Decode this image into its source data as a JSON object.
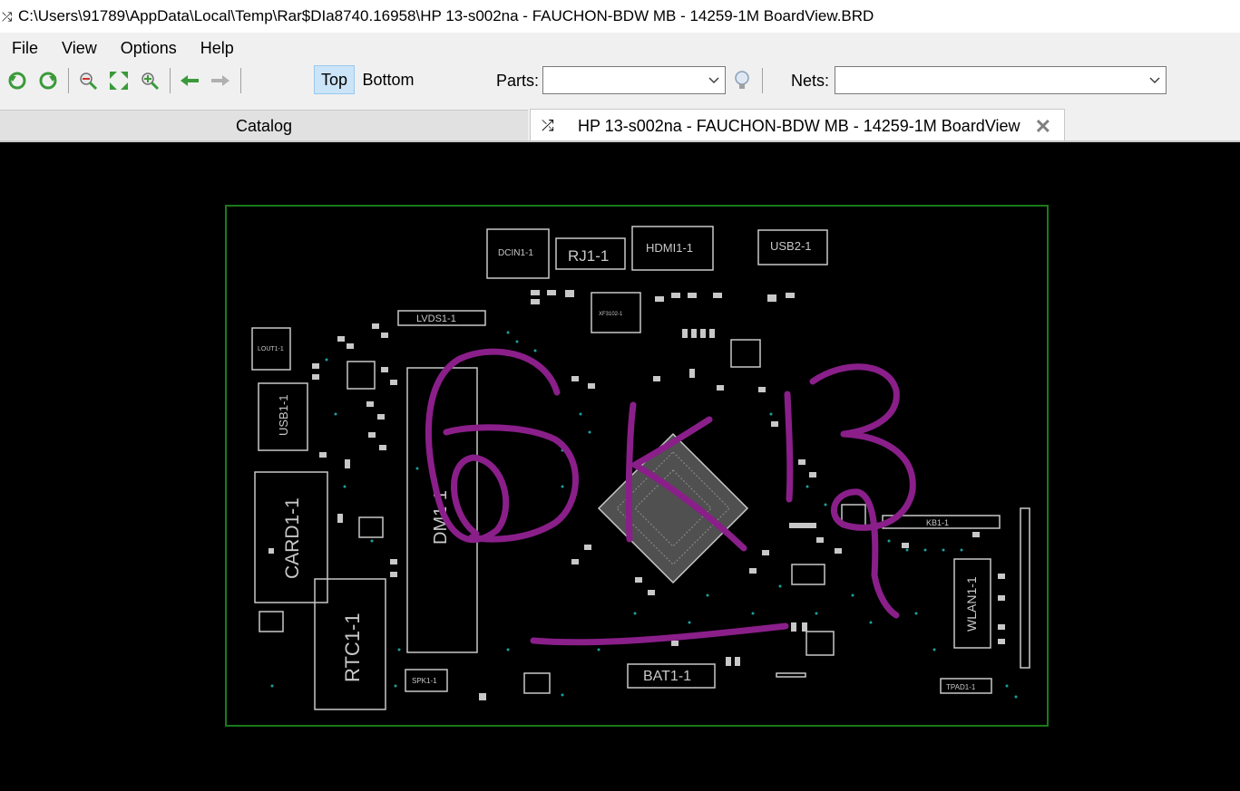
{
  "window": {
    "title": "C:\\Users\\91789\\AppData\\Local\\Temp\\Rar$DIa8740.16958\\HP 13-s002na - FAUCHON-BDW MB - 14259-1M BoardView.BRD"
  },
  "menu": {
    "items": [
      "File",
      "View",
      "Options",
      "Help"
    ]
  },
  "toolbar": {
    "icons": [
      "rotate-ccw-icon",
      "rotate-cw-icon",
      "zoom-out-icon",
      "fit-icon",
      "zoom-in-icon",
      "back-arrow-icon",
      "forward-arrow-icon"
    ],
    "side_top": "Top",
    "side_bottom": "Bottom",
    "parts_label": "Parts:",
    "parts_value": "",
    "nets_label": "Nets:",
    "nets_value": ""
  },
  "tabs": {
    "catalog": "Catalog",
    "board": "HP 13-s002na - FAUCHON-BDW MB - 14259-1M BoardView"
  },
  "board": {
    "components": {
      "dcin": "DCIN1-1",
      "rj": "RJ1-1",
      "hdmi": "HDMI1-1",
      "usb2": "USB2-1",
      "lvds": "LVDS1-1",
      "lout": "LOUT1-1",
      "usb1": "USB1-1",
      "card": "CARD1-1",
      "rtc": "RTC1-1",
      "dm": "DM1-1",
      "xf": "XF3102-1",
      "kb": "KB1-1",
      "wlan": "WLAN1-1",
      "bat": "BAT1-1",
      "spk": "SPK1-1",
      "tpad": "TPAD1-1"
    },
    "handwriting": "6K13",
    "colors": {
      "outline": "#1a7a1a",
      "component": "#c8c8c8",
      "pads": "#1aa0a0",
      "ink": "#8a1f8a"
    }
  }
}
